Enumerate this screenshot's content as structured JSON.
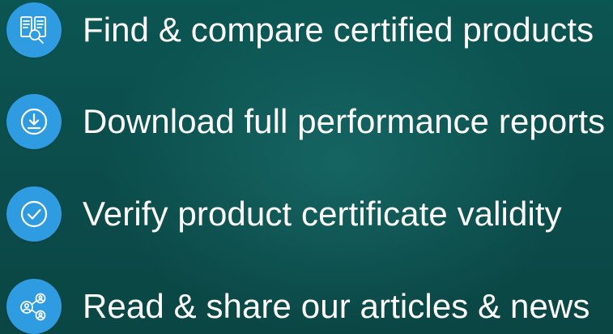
{
  "features": [
    {
      "label": "Find & compare certified products",
      "icon": "product-search-icon"
    },
    {
      "label": "Download full performance reports",
      "icon": "download-icon"
    },
    {
      "label": "Verify product certificate validity",
      "icon": "check-circle-icon"
    },
    {
      "label": "Read & share our articles & news",
      "icon": "share-network-icon"
    }
  ],
  "colors": {
    "icon_circle": "#2f9be0",
    "text": "#ffffff",
    "background": "#0b5553"
  }
}
